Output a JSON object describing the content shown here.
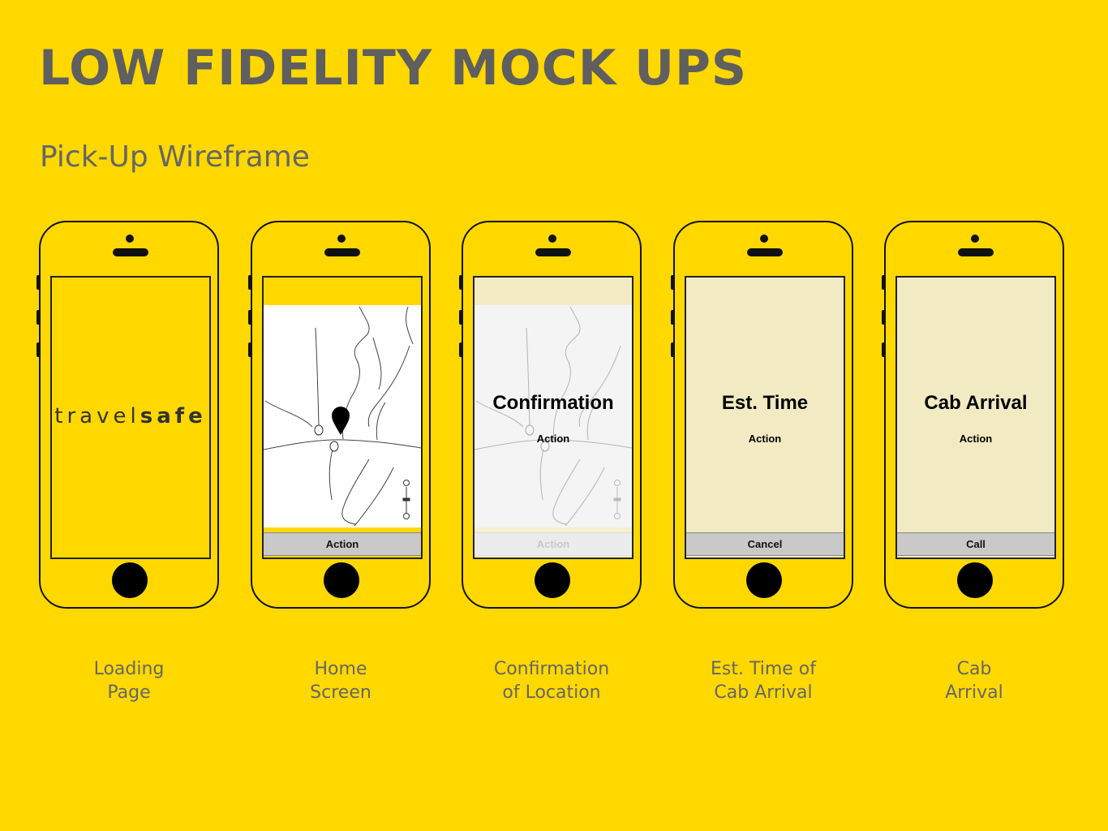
{
  "title": "LOW FIDELITY MOCK UPS",
  "subtitle": "Pick-Up Wireframe",
  "loading": {
    "logo_light": "travel",
    "logo_bold": "safe",
    "caption": "Loading Page"
  },
  "home": {
    "action_label": "Action",
    "caption": "Home Screen"
  },
  "confirmation": {
    "heading": "Confirmation",
    "action_text": "Action",
    "action_label": "Action",
    "caption": "Confirmation of Location"
  },
  "est_time": {
    "heading": "Est. Time",
    "action_text": "Action",
    "action_label": "Cancel",
    "caption": "Est. Time of Cab Arrival"
  },
  "cab_arrival": {
    "heading": "Cab Arrival",
    "action_text": "Action",
    "action_label": "Call",
    "caption": "Cab Arrival"
  },
  "colors": {
    "background": "#FFD800",
    "title_text": "#5f5f5f",
    "pale_screen": "#F2EAC2",
    "action_bar": "#C9C9C9"
  },
  "icons": [
    "map-pin-icon",
    "zoom-in-icon",
    "zoom-out-icon"
  ]
}
